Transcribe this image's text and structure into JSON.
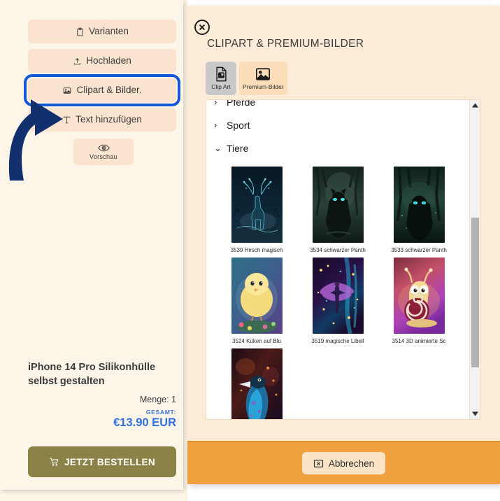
{
  "sidebar": {
    "buttons": [
      {
        "id": "varianten",
        "label": "Varianten",
        "icon": "clipboard-icon"
      },
      {
        "id": "hochladen",
        "label": "Hochladen",
        "icon": "upload-icon"
      },
      {
        "id": "clipart",
        "label": "Clipart & Bilder.",
        "icon": "image-icon",
        "highlighted": true
      },
      {
        "id": "text",
        "label": "Text hinzufügen",
        "icon": "text-icon"
      }
    ],
    "preview_button": {
      "label": "Vorschau",
      "icon": "eye-icon"
    },
    "product": {
      "title": "iPhone 14 Pro Silikonhülle selbst gestalten",
      "quantity_label": "Menge: 1",
      "total_label": "GESAMT:",
      "total_value": "€13.90 EUR"
    },
    "order_button": {
      "label": "JETZT BESTELLEN",
      "icon": "cart-icon"
    }
  },
  "annotation": {
    "highlight_color": "#1558d6",
    "arrow_color": "#12306e"
  },
  "modal": {
    "title": "CLIPART & PREMIUM-BILDER",
    "close_icon": "close-circle-icon",
    "tabs": [
      {
        "id": "clipart",
        "label": "Clip Art",
        "icon": "file-image-icon",
        "selected": true
      },
      {
        "id": "premium",
        "label": "Premium-Bilder",
        "icon": "picture-icon",
        "selected": false
      }
    ],
    "categories": [
      {
        "label": "Pferde",
        "expanded": false,
        "chevron": "chevron-right-icon"
      },
      {
        "label": "Sport",
        "expanded": false,
        "chevron": "chevron-right-icon"
      },
      {
        "label": "Tiere",
        "expanded": true,
        "chevron": "chevron-down-icon"
      }
    ],
    "images": [
      {
        "label": "3539 Hirsch magisch",
        "art": "deer"
      },
      {
        "label": "3534 schwarzer Panth",
        "art": "panther"
      },
      {
        "label": "3533 schwarzer Panth",
        "art": "panther2"
      },
      {
        "label": "3524 Küken auf Blu",
        "art": "chick"
      },
      {
        "label": "3519 magische Libell",
        "art": "dragonfly"
      },
      {
        "label": "3514 3D animierte Sc",
        "art": "snail"
      },
      {
        "label": "",
        "art": "bird"
      }
    ],
    "scrollbar": {
      "up_icon": "caret-up-icon",
      "down_icon": "caret-down-icon"
    },
    "footer": {
      "cancel_button": {
        "label": "Abbrechen",
        "icon": "close-box-icon"
      },
      "background": "#f0a03f"
    }
  },
  "colors": {
    "panel_bg": "#fdf6e8",
    "button_bg": "#fbe4cf",
    "modal_bg": "#fbebd7",
    "accent_blue": "#2f6fe0",
    "order_button": "#8b8247"
  }
}
